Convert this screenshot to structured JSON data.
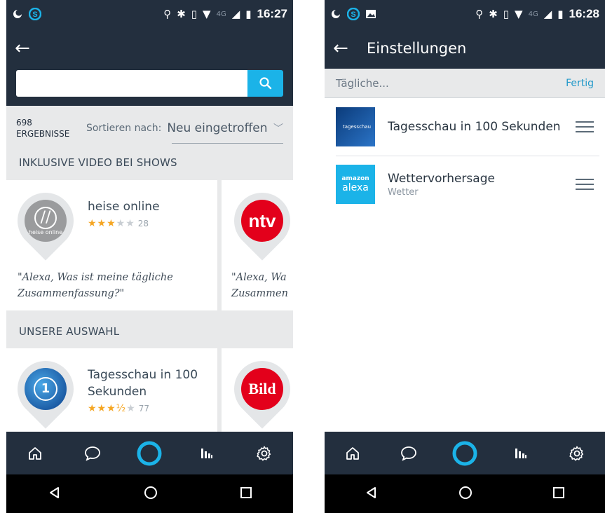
{
  "left": {
    "status": {
      "time": "16:27",
      "network": "4G"
    },
    "search": {
      "placeholder": ""
    },
    "results": {
      "count": "698",
      "count_label": "ERGEBNISSE",
      "sort_label": "Sortieren nach:",
      "sort_value": "Neu eingetroffen"
    },
    "section1": {
      "title": "INKLUSIVE VIDEO BEI SHOWS",
      "card1": {
        "name": "heise online",
        "icon_text": "heise online",
        "stars": "★★★",
        "stars_off": "★★",
        "reviews": "28",
        "quote": "\"Alexa, Was ist meine tägliche Zusammenfassung?\""
      },
      "card2": {
        "icon_text": "ntv",
        "quote": "\"Alexa, Wa Zusammen"
      }
    },
    "section2": {
      "title": "UNSERE AUSWAHL",
      "card1": {
        "name": "Tagesschau in 100 Sekunden",
        "stars": "★★★½",
        "stars_off": "★",
        "reviews": "77"
      },
      "card2": {
        "icon_text": "Bild"
      }
    }
  },
  "right": {
    "status": {
      "time": "16:28",
      "network": "4G"
    },
    "title": "Einstellungen",
    "query": "Tägliche...",
    "done": "Fertig",
    "items": [
      {
        "title": "Tagesschau in 100 Sekunden",
        "subtitle": "",
        "thumb_text": "tagesschau"
      },
      {
        "title": "Wettervorhersage",
        "subtitle": "Wetter",
        "thumb_top": "amazon",
        "thumb_bottom": "alexa"
      }
    ]
  },
  "colors": {
    "header": "#232f3e",
    "accent": "#1bb3e8",
    "star": "#f5a623",
    "alexa_ring": "#1bb3e8"
  },
  "icons": [
    "back-arrow-icon",
    "search-icon",
    "chevron-down-icon",
    "home-icon",
    "chat-icon",
    "alexa-icon",
    "activity-icon",
    "gear-icon",
    "nav-back-icon",
    "nav-home-icon",
    "nav-recents-icon",
    "drag-handle-icon"
  ]
}
